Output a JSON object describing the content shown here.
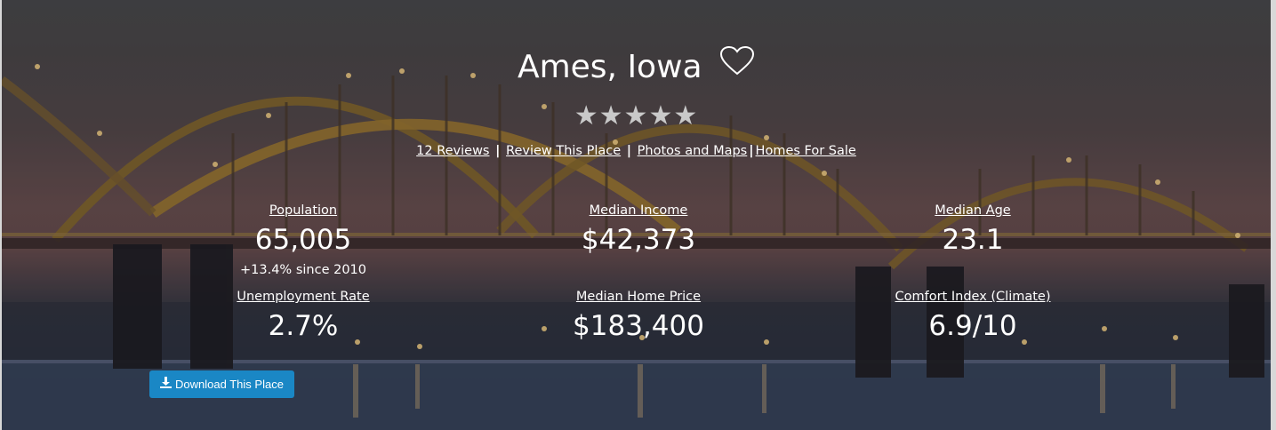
{
  "place": {
    "title": "Ames, Iowa",
    "favorite_icon": "heart-outline-icon",
    "rating_stars": 5,
    "rating_filled": 0,
    "star_color": "#c9c9c9"
  },
  "links": {
    "reviews": "12 Reviews",
    "review_place": "Review This Place",
    "photos_maps": "Photos and Maps",
    "homes_for_sale": "Homes For Sale",
    "separator": "|"
  },
  "stats": {
    "population": {
      "label": "Population",
      "value": "65,005",
      "sub": "+13.4% since 2010"
    },
    "median_income": {
      "label": "Median Income",
      "value": "$42,373"
    },
    "median_age": {
      "label": "Median Age",
      "value": "23.1"
    },
    "unemployment": {
      "label": "Unemployment Rate",
      "value": "2.7%"
    },
    "median_home_price": {
      "label": "Median Home Price",
      "value": "$183,400"
    },
    "comfort_index": {
      "label": "Comfort Index (Climate)",
      "value": "6.9/10"
    }
  },
  "download_button": {
    "label": "Download This Place",
    "icon": "download-icon",
    "color": "#1a87c5"
  }
}
